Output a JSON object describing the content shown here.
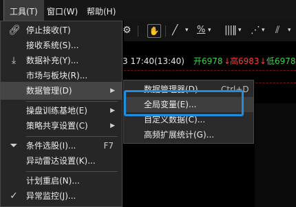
{
  "menubar": {
    "tools": "工具(T)",
    "window": "窗口(W)",
    "help": "帮助(H)"
  },
  "ticker": {
    "time": "3  17:40(13:40)",
    "open": "开6978",
    "high": "高6983",
    "low": "低6978",
    "open_arrow": "↓",
    "high_arrow": "↓"
  },
  "toolbar": {
    "percent_icon": "%"
  },
  "tools_menu": {
    "items": [
      {
        "label": "停止接收(T)",
        "icon": "link-icon"
      },
      {
        "label": "接收系统(S)...",
        "icon": ""
      },
      {
        "label": "数据补充(Y)...",
        "icon": "download-icon"
      },
      {
        "label": "市场与板块(R)...",
        "icon": ""
      },
      {
        "label": "数据管理(D)",
        "icon": ""
      },
      {
        "label": "操盘训练基地(E)",
        "icon": ""
      },
      {
        "label": "策略共享设置(C)",
        "icon": ""
      },
      {
        "label": "条件选股(I)...",
        "icon": "filter-icon",
        "shortcut": "F7"
      },
      {
        "label": "异动雷达设置(K)...",
        "icon": ""
      },
      {
        "label": "计划重启(N)...",
        "icon": ""
      },
      {
        "label": "异常监控(J)...",
        "icon": "check-icon"
      }
    ]
  },
  "data_submenu": {
    "items": [
      {
        "label": "数据管理器(D)...",
        "shortcut": "Ctrl+D"
      },
      {
        "label": "全局变量(E)..."
      },
      {
        "label": "自定义数据(C)..."
      },
      {
        "label": "高频扩展统计(G)..."
      }
    ]
  },
  "colors": {
    "accent": "#1e8fe0",
    "up": "#3ad44a",
    "down": "#ff3b3b"
  }
}
